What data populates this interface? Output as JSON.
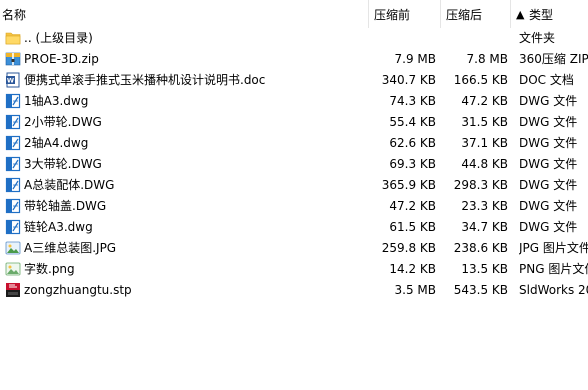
{
  "columns": {
    "name": "名称",
    "compressed": "压缩前",
    "original": "压缩后",
    "sort_indicator": "▲",
    "type": "类型"
  },
  "files": [
    {
      "name": ".. (上级目录)",
      "compressed": "",
      "original": "",
      "type": "文件夹",
      "icon": "folder-up-icon"
    },
    {
      "name": "PROE-3D.zip",
      "compressed": "7.9 MB",
      "original": "7.8 MB",
      "type": "360压缩 ZIP",
      "icon": "zip-archive-icon"
    },
    {
      "name": "便携式单滚手推式玉米播种机设计说明书.doc",
      "compressed": "340.7 KB",
      "original": "166.5 KB",
      "type": "DOC 文档",
      "icon": "word-document-icon"
    },
    {
      "name": "1轴A3.dwg",
      "compressed": "74.3 KB",
      "original": "47.2 KB",
      "type": "DWG 文件",
      "icon": "dwg-file-icon"
    },
    {
      "name": "2小带轮.DWG",
      "compressed": "55.4 KB",
      "original": "31.5 KB",
      "type": "DWG 文件",
      "icon": "dwg-file-icon"
    },
    {
      "name": "2轴A4.dwg",
      "compressed": "62.6 KB",
      "original": "37.1 KB",
      "type": "DWG 文件",
      "icon": "dwg-file-icon"
    },
    {
      "name": "3大带轮.DWG",
      "compressed": "69.3 KB",
      "original": "44.8 KB",
      "type": "DWG 文件",
      "icon": "dwg-file-icon"
    },
    {
      "name": "A总装配体.DWG",
      "compressed": "365.9 KB",
      "original": "298.3 KB",
      "type": "DWG 文件",
      "icon": "dwg-file-icon"
    },
    {
      "name": "带轮轴盖.DWG",
      "compressed": "47.2 KB",
      "original": "23.3 KB",
      "type": "DWG 文件",
      "icon": "dwg-file-icon"
    },
    {
      "name": "链轮A3.dwg",
      "compressed": "61.5 KB",
      "original": "34.7 KB",
      "type": "DWG 文件",
      "icon": "dwg-file-icon"
    },
    {
      "name": "A三维总装图.JPG",
      "compressed": "259.8 KB",
      "original": "238.6 KB",
      "type": "JPG 图片文件",
      "icon": "jpg-image-icon"
    },
    {
      "name": "字数.png",
      "compressed": "14.2 KB",
      "original": "13.5 KB",
      "type": "PNG 图片文件",
      "icon": "png-image-icon"
    },
    {
      "name": "zongzhuangtu.stp",
      "compressed": "3.5 MB",
      "original": "543.5 KB",
      "type": "SldWorks 20",
      "icon": "solidworks-file-icon"
    }
  ]
}
